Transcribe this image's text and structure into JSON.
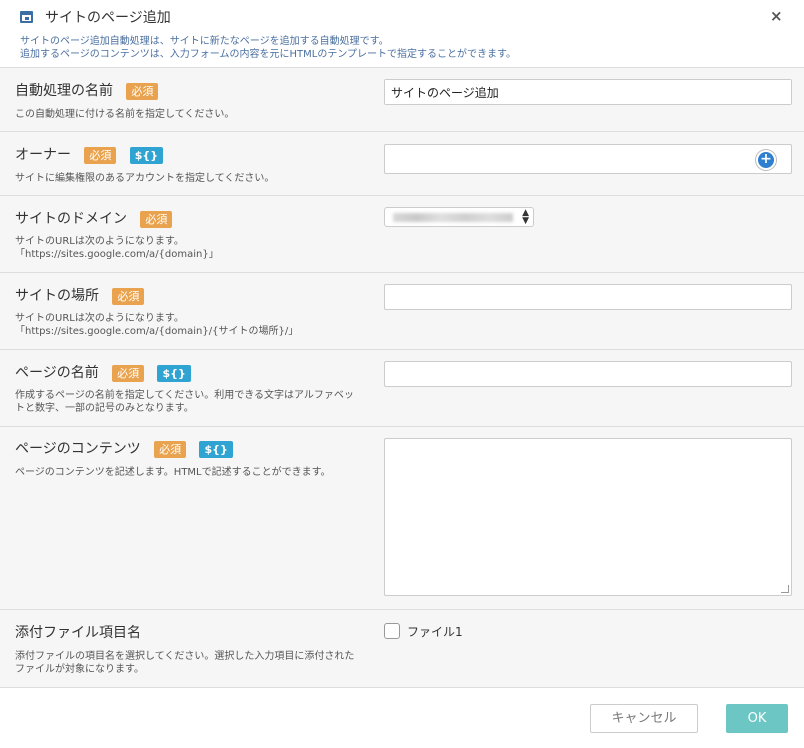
{
  "dialog": {
    "title": "サイトのページ追加",
    "desc_line1": "サイトのページ追加自動処理は、サイトに新たなページを追加する自動処理です。",
    "desc_line2": "追加するページのコンテンツは、入力フォームの内容を元にHTMLのテンプレートで指定することができます。",
    "close_icon": "×"
  },
  "badges": {
    "required": "必須",
    "variable": "${}"
  },
  "fields": {
    "name": {
      "label": "自動処理の名前",
      "help": "この自動処理に付ける名前を指定してください。",
      "value": "サイトのページ追加"
    },
    "owner": {
      "label": "オーナー",
      "help": "サイトに編集権限のあるアカウントを指定してください。",
      "value": "",
      "add_icon": "+"
    },
    "domain": {
      "label": "サイトのドメイン",
      "help_line1": "サイトのURLは次のようになります。",
      "help_line2": "「https://sites.google.com/a/{domain}」",
      "selected": ""
    },
    "location": {
      "label": "サイトの場所",
      "help_line1": "サイトのURLは次のようになります。",
      "help_line2": "「https://sites.google.com/a/{domain}/{サイトの場所}/」",
      "value": ""
    },
    "page_name": {
      "label": "ページの名前",
      "help": "作成するページの名前を指定してください。利用できる文字はアルファベットと数字、一部の記号のみとなります。",
      "value": ""
    },
    "content": {
      "label": "ページのコンテンツ",
      "help": "ページのコンテンツを記述します。HTMLで記述することができます。",
      "value": ""
    },
    "attachment": {
      "label": "添付ファイル項目名",
      "help": "添付ファイルの項目名を選択してください。選択した入力項目に添付されたファイルが対象になります。",
      "option_label": "ファイル1",
      "checked": false
    }
  },
  "footer": {
    "cancel_label": "キャンセル",
    "ok_label": "OK"
  },
  "colors": {
    "required_badge": "#e9a24e",
    "variable_badge": "#2fa3d1",
    "ok_button": "#6cc6c4"
  }
}
